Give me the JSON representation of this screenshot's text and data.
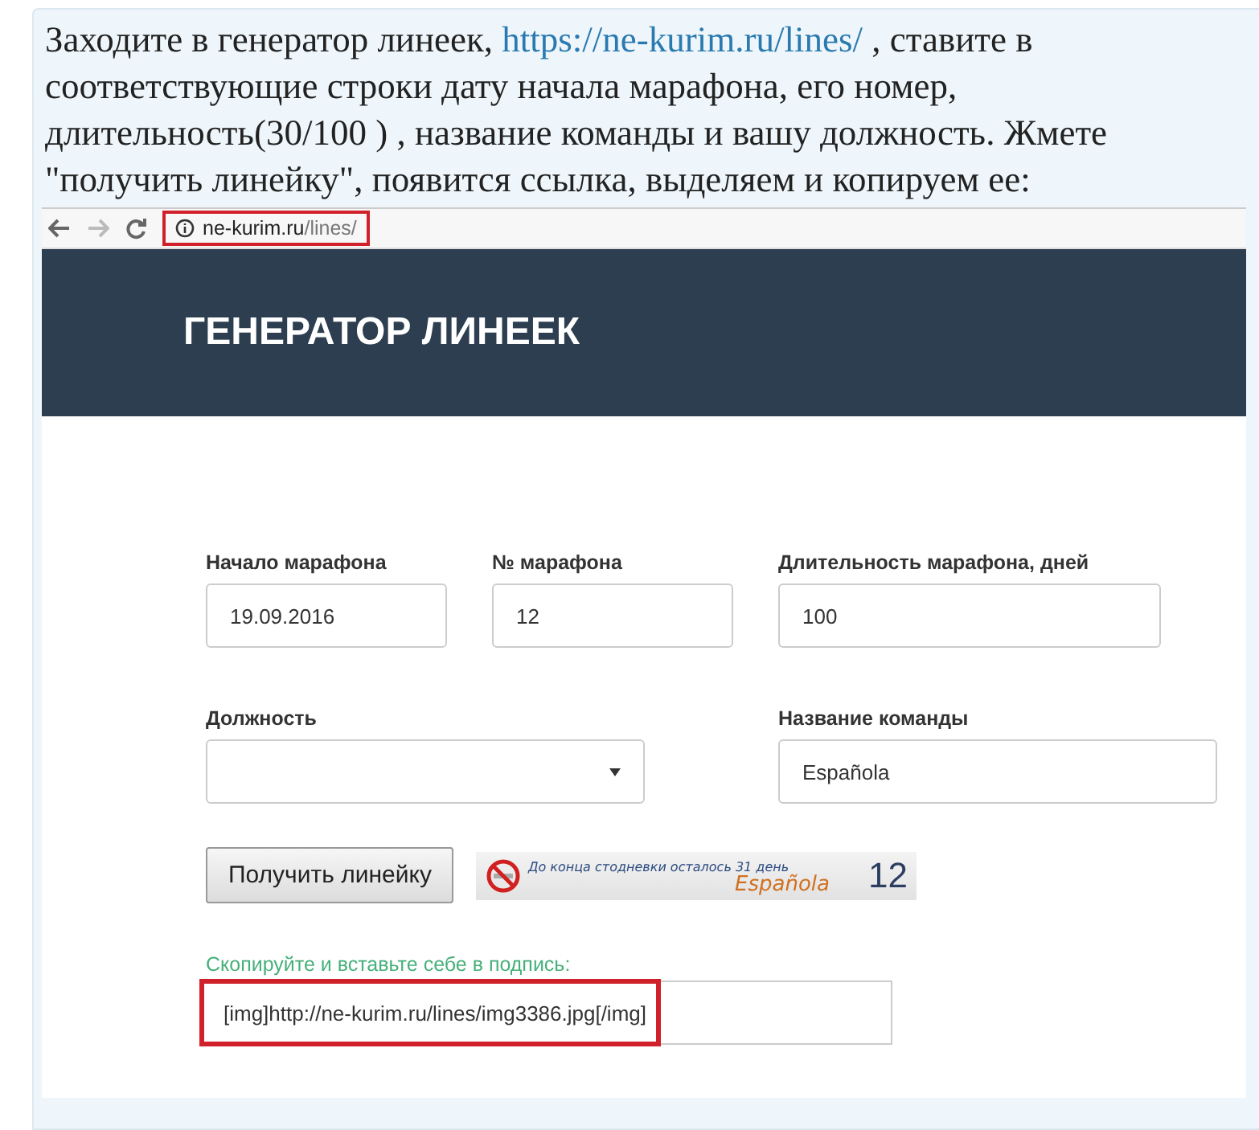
{
  "intro": {
    "before": "Заходите в генератор линеек, ",
    "link": "https://ne-kurim.ru/lines/",
    "after": " , ставите в соответствующие строки дату начала марафона, его номер, длительность(30/100 ) , название команды и вашу должность. Жмете \"получить линейку\", появится ссылка, выделяем и копируем ее:"
  },
  "browser": {
    "host": "ne-kurim.ru",
    "path": "/lines/",
    "highlighted": true
  },
  "site": {
    "title": "ГЕНЕРАТОР ЛИНЕЕК",
    "fields": [
      {
        "kind": "text",
        "label": "Начало марафона",
        "value": "19.09.2016"
      },
      {
        "kind": "text",
        "label": "№ марафона",
        "value": "12"
      },
      {
        "kind": "text",
        "label": "Длительность марафона, дней",
        "value": "100"
      },
      {
        "kind": "select",
        "label": "Должность"
      },
      {
        "kind": "text",
        "label": "Название команды",
        "value": "Española"
      }
    ],
    "button": "Получить линейку",
    "banner": {
      "caption": "До конца стодневки осталось 31 день",
      "team": "Española",
      "number": "12"
    },
    "hint": "Скопируйте и вставьте себе в подпись:",
    "output": {
      "value": "[img]http://ne-kurim.ru/lines/img3386.jpg[/img]",
      "highlighted": true
    }
  }
}
